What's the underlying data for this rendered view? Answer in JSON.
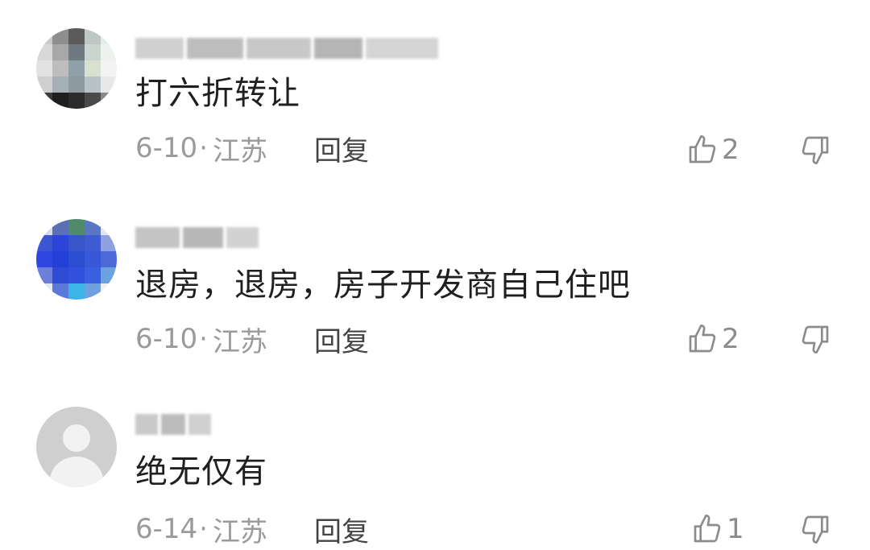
{
  "colors": {
    "text": "#1f1f1f",
    "meta": "#9a9a9a",
    "reply": "#444444",
    "icon": "#8c8c8c"
  },
  "comments": [
    {
      "text": "打六折转让",
      "date": "6-10",
      "location": "江苏",
      "reply_label": "回复",
      "likes": "2",
      "avatar": "blurred-photo",
      "like_icon": "thumbs-up-icon",
      "dislike_icon": "thumbs-down-icon"
    },
    {
      "text": "退房，退房，房子开发商自己住吧",
      "date": "6-10",
      "location": "江苏",
      "reply_label": "回复",
      "likes": "2",
      "avatar": "blurred-photo",
      "like_icon": "thumbs-up-icon",
      "dislike_icon": "thumbs-down-icon"
    },
    {
      "text": "绝无仅有",
      "date": "6-14",
      "location": "江苏",
      "reply_label": "回复",
      "likes": "1",
      "avatar": "default-avatar",
      "like_icon": "thumbs-up-icon",
      "dislike_icon": "thumbs-down-icon"
    }
  ]
}
